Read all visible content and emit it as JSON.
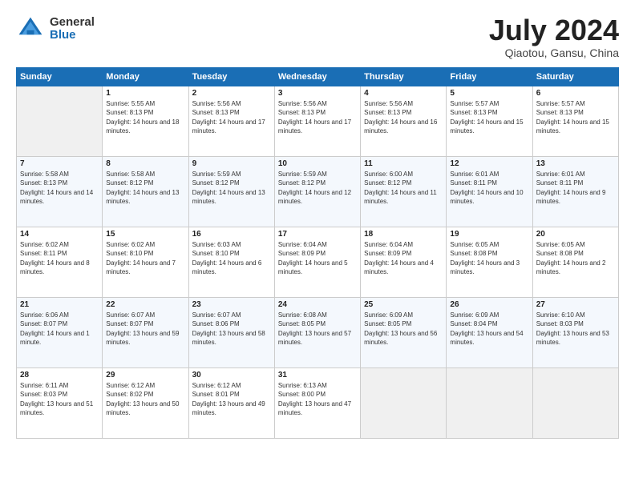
{
  "header": {
    "logo_general": "General",
    "logo_blue": "Blue",
    "month_title": "July 2024",
    "location": "Qiaotou, Gansu, China"
  },
  "days_of_week": [
    "Sunday",
    "Monday",
    "Tuesday",
    "Wednesday",
    "Thursday",
    "Friday",
    "Saturday"
  ],
  "weeks": [
    [
      {
        "day": "",
        "empty": true
      },
      {
        "day": "1",
        "sunrise": "5:55 AM",
        "sunset": "8:13 PM",
        "daylight": "14 hours and 18 minutes."
      },
      {
        "day": "2",
        "sunrise": "5:56 AM",
        "sunset": "8:13 PM",
        "daylight": "14 hours and 17 minutes."
      },
      {
        "day": "3",
        "sunrise": "5:56 AM",
        "sunset": "8:13 PM",
        "daylight": "14 hours and 17 minutes."
      },
      {
        "day": "4",
        "sunrise": "5:56 AM",
        "sunset": "8:13 PM",
        "daylight": "14 hours and 16 minutes."
      },
      {
        "day": "5",
        "sunrise": "5:57 AM",
        "sunset": "8:13 PM",
        "daylight": "14 hours and 15 minutes."
      },
      {
        "day": "6",
        "sunrise": "5:57 AM",
        "sunset": "8:13 PM",
        "daylight": "14 hours and 15 minutes."
      }
    ],
    [
      {
        "day": "7",
        "sunrise": "5:58 AM",
        "sunset": "8:13 PM",
        "daylight": "14 hours and 14 minutes."
      },
      {
        "day": "8",
        "sunrise": "5:58 AM",
        "sunset": "8:12 PM",
        "daylight": "14 hours and 13 minutes."
      },
      {
        "day": "9",
        "sunrise": "5:59 AM",
        "sunset": "8:12 PM",
        "daylight": "14 hours and 13 minutes."
      },
      {
        "day": "10",
        "sunrise": "5:59 AM",
        "sunset": "8:12 PM",
        "daylight": "14 hours and 12 minutes."
      },
      {
        "day": "11",
        "sunrise": "6:00 AM",
        "sunset": "8:12 PM",
        "daylight": "14 hours and 11 minutes."
      },
      {
        "day": "12",
        "sunrise": "6:01 AM",
        "sunset": "8:11 PM",
        "daylight": "14 hours and 10 minutes."
      },
      {
        "day": "13",
        "sunrise": "6:01 AM",
        "sunset": "8:11 PM",
        "daylight": "14 hours and 9 minutes."
      }
    ],
    [
      {
        "day": "14",
        "sunrise": "6:02 AM",
        "sunset": "8:11 PM",
        "daylight": "14 hours and 8 minutes."
      },
      {
        "day": "15",
        "sunrise": "6:02 AM",
        "sunset": "8:10 PM",
        "daylight": "14 hours and 7 minutes."
      },
      {
        "day": "16",
        "sunrise": "6:03 AM",
        "sunset": "8:10 PM",
        "daylight": "14 hours and 6 minutes."
      },
      {
        "day": "17",
        "sunrise": "6:04 AM",
        "sunset": "8:09 PM",
        "daylight": "14 hours and 5 minutes."
      },
      {
        "day": "18",
        "sunrise": "6:04 AM",
        "sunset": "8:09 PM",
        "daylight": "14 hours and 4 minutes."
      },
      {
        "day": "19",
        "sunrise": "6:05 AM",
        "sunset": "8:08 PM",
        "daylight": "14 hours and 3 minutes."
      },
      {
        "day": "20",
        "sunrise": "6:05 AM",
        "sunset": "8:08 PM",
        "daylight": "14 hours and 2 minutes."
      }
    ],
    [
      {
        "day": "21",
        "sunrise": "6:06 AM",
        "sunset": "8:07 PM",
        "daylight": "14 hours and 1 minute."
      },
      {
        "day": "22",
        "sunrise": "6:07 AM",
        "sunset": "8:07 PM",
        "daylight": "13 hours and 59 minutes."
      },
      {
        "day": "23",
        "sunrise": "6:07 AM",
        "sunset": "8:06 PM",
        "daylight": "13 hours and 58 minutes."
      },
      {
        "day": "24",
        "sunrise": "6:08 AM",
        "sunset": "8:05 PM",
        "daylight": "13 hours and 57 minutes."
      },
      {
        "day": "25",
        "sunrise": "6:09 AM",
        "sunset": "8:05 PM",
        "daylight": "13 hours and 56 minutes."
      },
      {
        "day": "26",
        "sunrise": "6:09 AM",
        "sunset": "8:04 PM",
        "daylight": "13 hours and 54 minutes."
      },
      {
        "day": "27",
        "sunrise": "6:10 AM",
        "sunset": "8:03 PM",
        "daylight": "13 hours and 53 minutes."
      }
    ],
    [
      {
        "day": "28",
        "sunrise": "6:11 AM",
        "sunset": "8:03 PM",
        "daylight": "13 hours and 51 minutes."
      },
      {
        "day": "29",
        "sunrise": "6:12 AM",
        "sunset": "8:02 PM",
        "daylight": "13 hours and 50 minutes."
      },
      {
        "day": "30",
        "sunrise": "6:12 AM",
        "sunset": "8:01 PM",
        "daylight": "13 hours and 49 minutes."
      },
      {
        "day": "31",
        "sunrise": "6:13 AM",
        "sunset": "8:00 PM",
        "daylight": "13 hours and 47 minutes."
      },
      {
        "day": "",
        "empty": true
      },
      {
        "day": "",
        "empty": true
      },
      {
        "day": "",
        "empty": true
      }
    ]
  ],
  "labels": {
    "sunrise_prefix": "Sunrise: ",
    "sunset_prefix": "Sunset: ",
    "daylight_prefix": "Daylight: "
  }
}
